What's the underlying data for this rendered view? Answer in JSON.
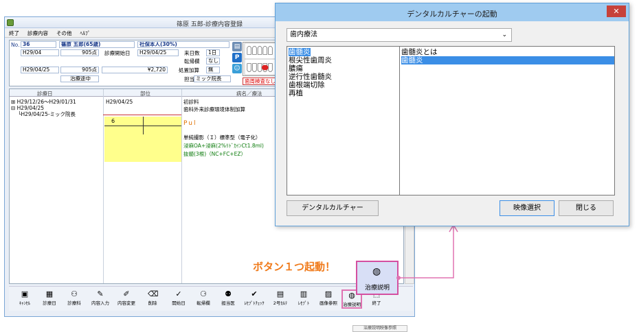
{
  "main_window": {
    "title": "篠原 五郎-診療内容登録",
    "menu": [
      "終了",
      "診療内容",
      "その他",
      "ﾍﾙﾌﾟ"
    ],
    "patient": {
      "no_label": "No.",
      "no": "36",
      "name": "篠原 五郎(65歳)",
      "insurance": "社保本人(30%)",
      "date1": "H29/04",
      "points1": "905点",
      "start_label": "診療開始日",
      "start_date": "H29/04/25",
      "visits_label": "来日数",
      "visits": "1日",
      "exam_label": "転帰欄",
      "exam": "なし",
      "date2": "H29/04/25",
      "points2": "905点",
      "amount": "¥2,720",
      "treat_label": "処置加算",
      "treat": "無",
      "status": "治療途中",
      "doctor_label": "担当医",
      "doctor": "ミック院長",
      "alert": "歯周検査なし"
    },
    "grid": {
      "headers": [
        "診療日",
        "部位",
        "病名／療法"
      ],
      "tree": [
        "H29/12/26～H29/01/31",
        "H29/04/25",
        "H29/04/25-ミック院長"
      ],
      "site": "H29/04/25",
      "tooth": "6",
      "lines": [
        "初診料",
        "歯科外来診療環境体制加算",
        "Pul",
        "単純撮影（Ｉ）標準型（電子化）",
        "浸麻OA+浸麻(2%ﾘﾄﾞｶｲﾝCt1.8ml)",
        "抜髄(3根)（NC+FC+EZ）"
      ]
    },
    "toolbar": [
      {
        "label": "ｷｬﾝｾﾙ",
        "icon": "▣"
      },
      {
        "label": "診療日",
        "icon": "▦"
      },
      {
        "label": "診療科",
        "icon": "⚇"
      },
      {
        "label": "内容入力",
        "icon": "✎"
      },
      {
        "label": "内容変更",
        "icon": "✐"
      },
      {
        "label": "削除",
        "icon": "⌫"
      },
      {
        "label": "開始日",
        "icon": "✓"
      },
      {
        "label": "転帰欄",
        "icon": "⚆"
      },
      {
        "label": "担当医",
        "icon": "⚉"
      },
      {
        "label": "ﾚｾﾌﾟﾄﾁｪｯｸ",
        "icon": "✔"
      },
      {
        "label": "2号ｶﾙﾃ",
        "icon": "▤"
      },
      {
        "label": "ﾚｾﾌﾟﾄ",
        "icon": "▥"
      },
      {
        "label": "画像参照",
        "icon": "▨"
      },
      {
        "label": "治療説明",
        "icon": "◍"
      },
      {
        "label": "終了",
        "icon": "⬚"
      }
    ],
    "status_tip": "治療説明映像参照"
  },
  "callout": {
    "text": "ボタン１つ起動！",
    "button_label": "治療説明",
    "highlight_color": "#e072b1"
  },
  "dialog": {
    "title": "デンタルカルチャーの起動",
    "close": "✕",
    "dropdown_value": "歯内療法",
    "left_items": [
      "歯髄炎",
      "根尖性歯周炎",
      "膿瘍",
      "逆行性歯髄炎",
      "歯根端切除",
      "再植"
    ],
    "left_selected": 0,
    "right_items": [
      "歯髄炎とは",
      "歯髄炎"
    ],
    "right_selected": 1,
    "buttons": {
      "culture": "デンタルカルチャー",
      "select": "映像選択",
      "close": "閉じる"
    }
  }
}
